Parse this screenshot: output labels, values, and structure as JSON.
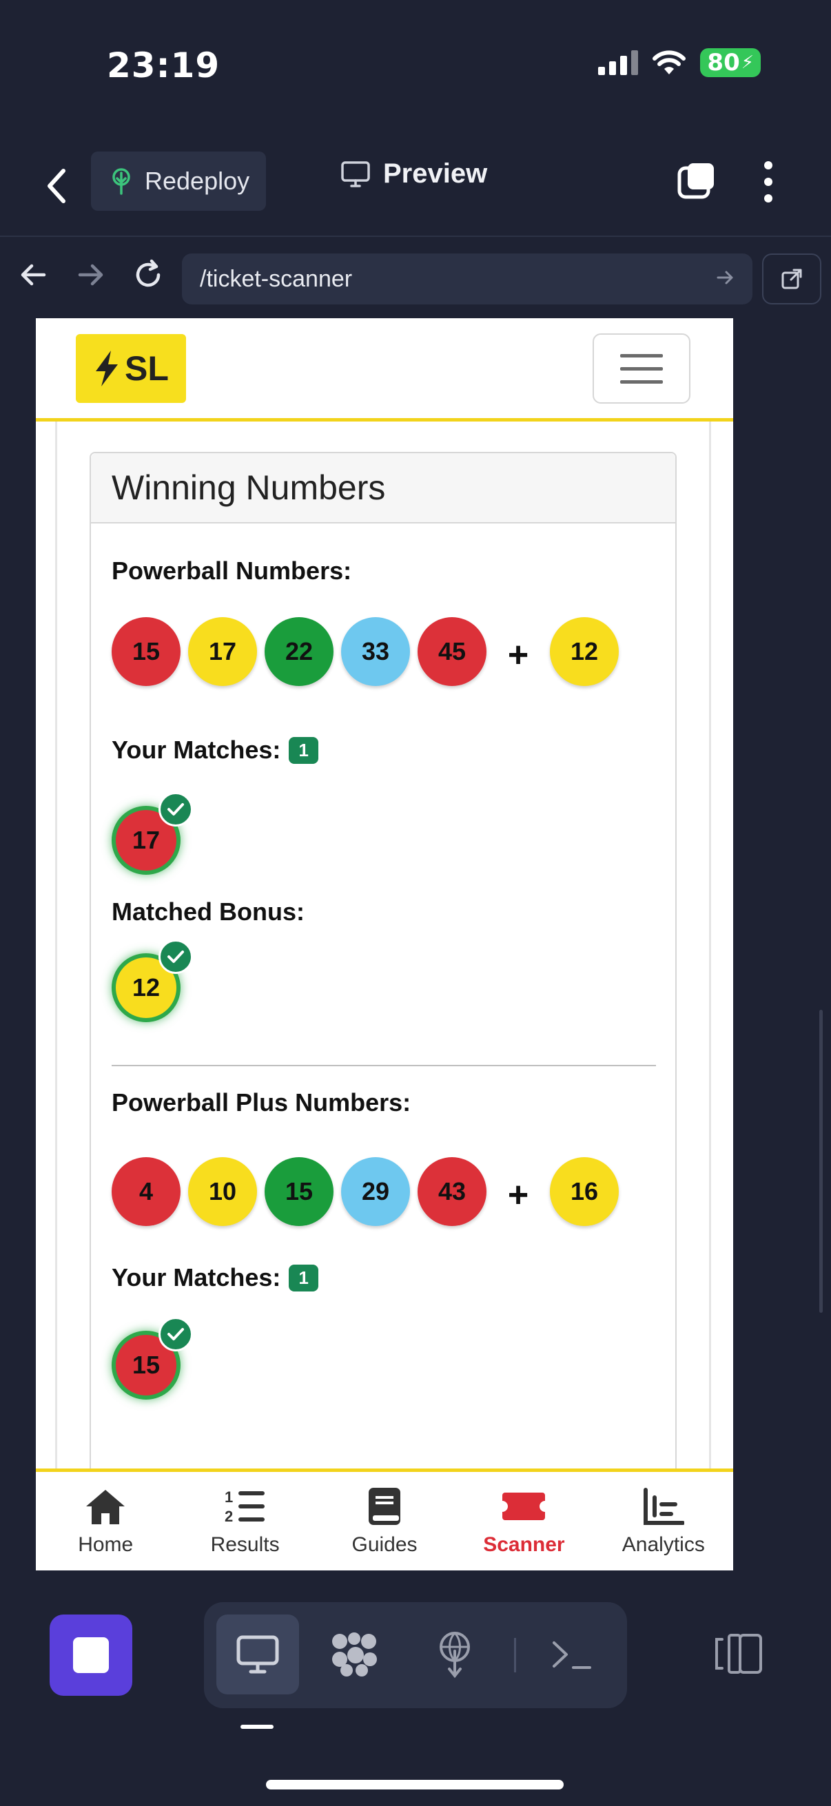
{
  "status_bar": {
    "time": "23:19",
    "battery": "80"
  },
  "header": {
    "redeploy_label": "Redeploy",
    "preview_label": "Preview"
  },
  "urlbar": {
    "url": "/ticket-scanner"
  },
  "site": {
    "logo_text": "SL"
  },
  "card": {
    "title": "Winning Numbers",
    "powerball": {
      "label": "Powerball Numbers:",
      "balls": [
        {
          "n": "15",
          "color": "#dc3139"
        },
        {
          "n": "17",
          "color": "#f8dd1e"
        },
        {
          "n": "22",
          "color": "#1a9d3c"
        },
        {
          "n": "33",
          "color": "#6ec8ef"
        },
        {
          "n": "45",
          "color": "#dc3139"
        }
      ],
      "plus": "+",
      "bonus": {
        "n": "12",
        "color": "#f8dd1e"
      },
      "matches_label": "Your Matches:",
      "matches_count": "1",
      "matched_ball": {
        "n": "17",
        "color": "#dc3139"
      },
      "matched_bonus_label": "Matched Bonus:",
      "matched_bonus_ball": {
        "n": "12",
        "color": "#f8dd1e"
      }
    },
    "powerball_plus": {
      "label": "Powerball Plus Numbers:",
      "balls": [
        {
          "n": "4",
          "color": "#dc3139"
        },
        {
          "n": "10",
          "color": "#f8dd1e"
        },
        {
          "n": "15",
          "color": "#1a9d3c"
        },
        {
          "n": "29",
          "color": "#6ec8ef"
        },
        {
          "n": "43",
          "color": "#dc3139"
        }
      ],
      "plus": "+",
      "bonus": {
        "n": "16",
        "color": "#f8dd1e"
      },
      "matches_label": "Your Matches:",
      "matches_count": "1",
      "matched_ball": {
        "n": "15",
        "color": "#dc3139"
      }
    }
  },
  "bottom_nav": [
    {
      "label": "Home",
      "icon": "home-icon"
    },
    {
      "label": "Results",
      "icon": "list-ordered-icon"
    },
    {
      "label": "Guides",
      "icon": "book-icon"
    },
    {
      "label": "Scanner",
      "icon": "ticket-icon",
      "active": true
    },
    {
      "label": "Analytics",
      "icon": "chart-icon"
    }
  ],
  "colors": {
    "accent_yellow": "#f2d31b",
    "active_red": "#dc2d37",
    "badge_green": "#198754"
  }
}
